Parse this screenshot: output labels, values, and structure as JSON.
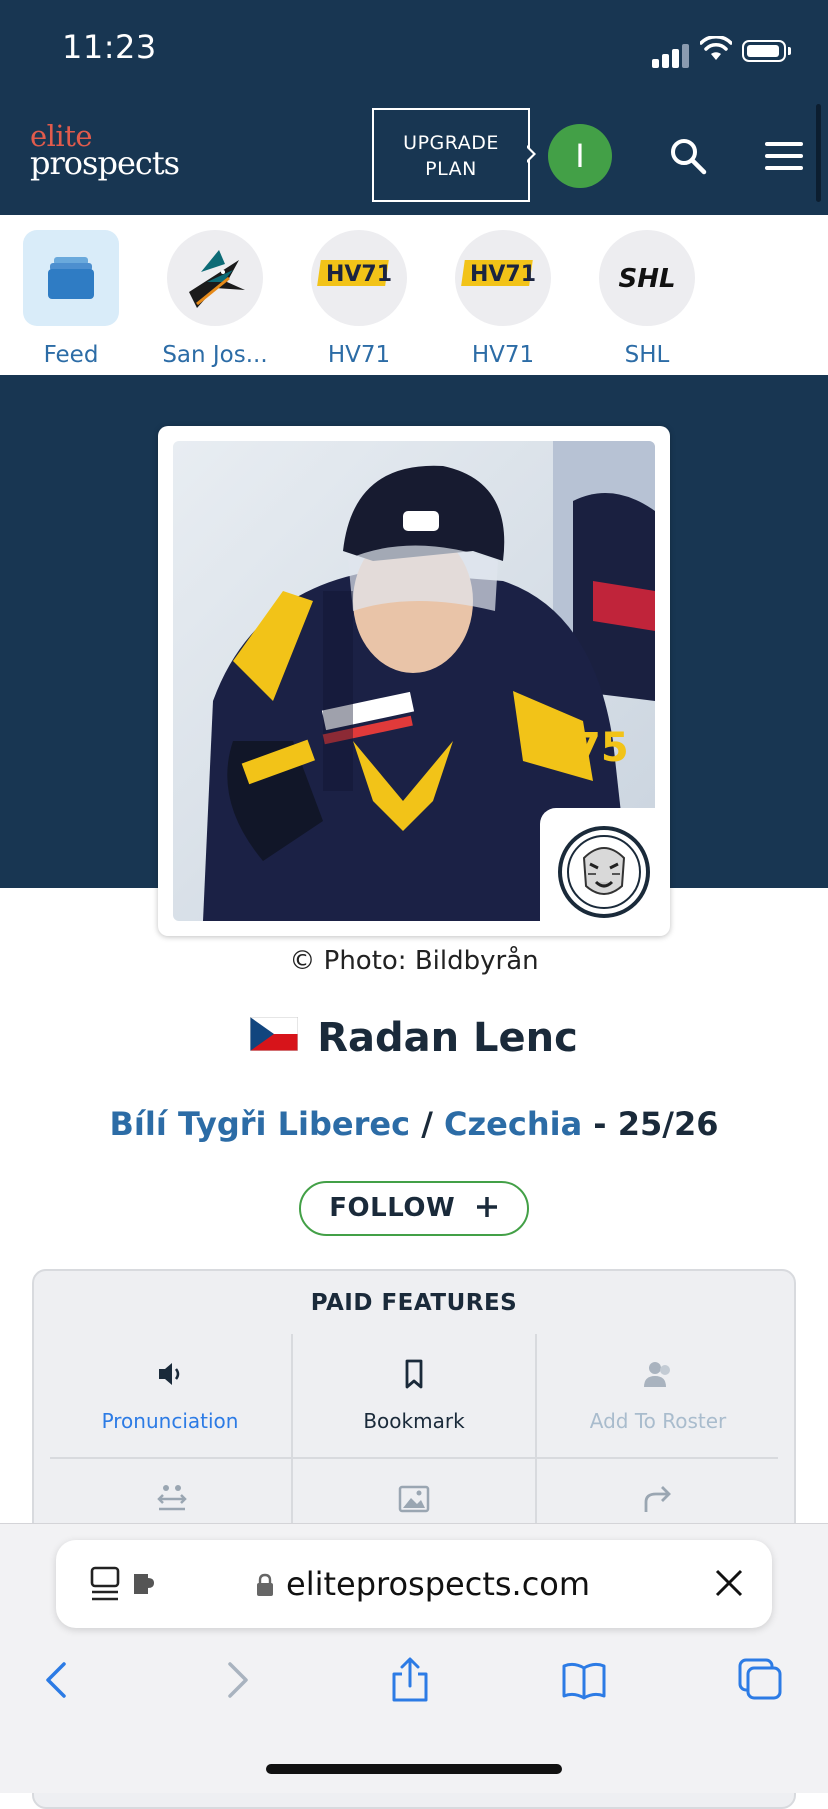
{
  "status": {
    "time": "11:23"
  },
  "header": {
    "logo_top": "elite",
    "logo_bottom": "prospects",
    "upgrade_line1": "UPGRADE",
    "upgrade_line2": "PLAN",
    "avatar_initial": "I",
    "icons": [
      "search-icon",
      "hamburger-menu-icon"
    ],
    "colors": {
      "navy": "#183652",
      "logo_red": "#e05b4c",
      "avatar_green": "#43a047"
    }
  },
  "favorites": [
    {
      "label": "Feed",
      "icon": "feed-stack-icon"
    },
    {
      "label": "San Jos...",
      "icon": "sharks-logo"
    },
    {
      "label": "HV71",
      "icon": "hv71-logo"
    },
    {
      "label": "HV71",
      "icon": "hv71-logo"
    },
    {
      "label": "SHL",
      "icon": "shl-logo"
    }
  ],
  "player": {
    "photo_credit": "© Photo: Bildbyrån",
    "flag": "czech-flag",
    "name": "Radan Lenc",
    "team": "Bílí Tygři Liberec",
    "separator": " / ",
    "country": "Czechia",
    "season": " - 25/26",
    "follow_label": "FOLLOW",
    "follow_icon": "plus-icon"
  },
  "paid_features": {
    "title": "PAID FEATURES",
    "items": [
      {
        "label": "Pronunciation",
        "icon": "speaker-icon",
        "color": "#2c7be5"
      },
      {
        "label": "Bookmark",
        "icon": "bookmark-icon",
        "color": "#1a2a3a"
      },
      {
        "label": "Add To Roster",
        "icon": "add-user-icon",
        "color": "#a9bccd"
      }
    ],
    "second_row_icons": [
      "compare-icon",
      "image-icon",
      "share-arrow-icon"
    ]
  },
  "browser": {
    "url": "eliteprospects.com",
    "icons": [
      "back-icon",
      "forward-icon",
      "share-icon",
      "bookmarks-icon",
      "tabs-icon"
    ]
  }
}
